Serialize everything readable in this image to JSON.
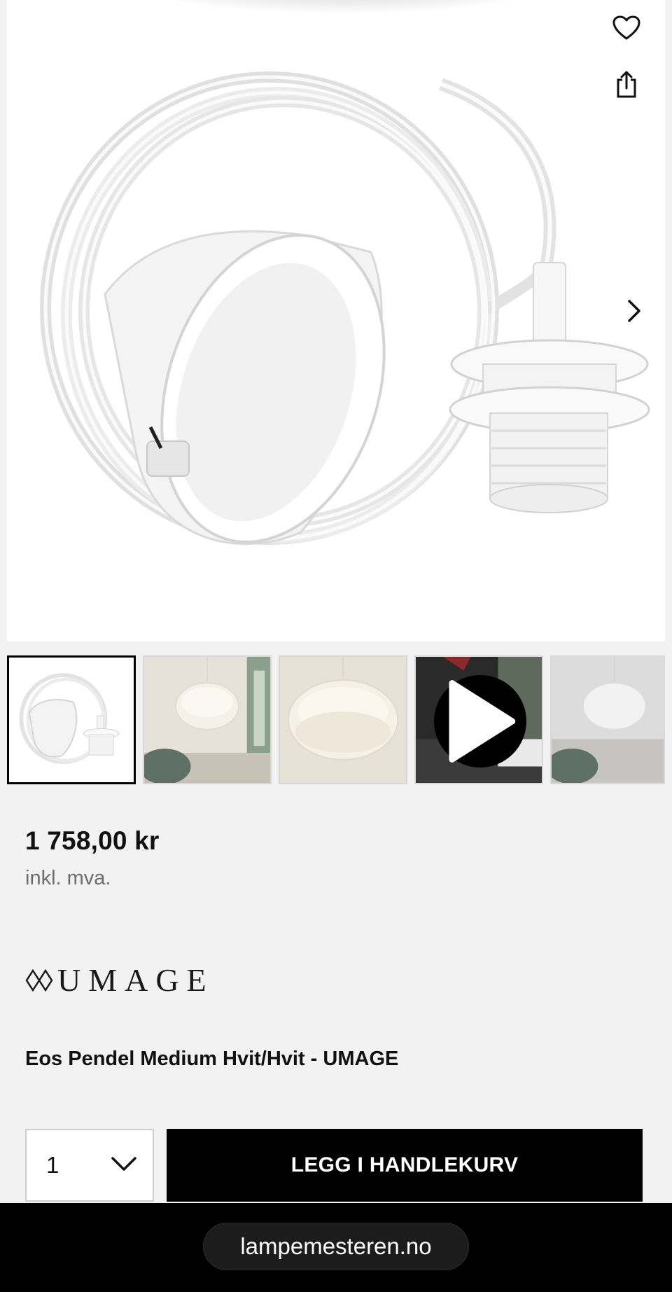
{
  "gallery": {
    "favorite_icon": "heart-outline-icon",
    "share_icon": "share-icon",
    "next_icon": "chevron-right-icon",
    "thumbnails": [
      {
        "kind": "image",
        "subject": "cord set",
        "active": true
      },
      {
        "kind": "image",
        "subject": "feather pendant in room"
      },
      {
        "kind": "image",
        "subject": "feather pendant close-up"
      },
      {
        "kind": "video",
        "subject": "assembly video",
        "play_icon": "play-icon"
      },
      {
        "kind": "image",
        "subject": "feather pendant white"
      }
    ]
  },
  "product": {
    "price": "1 758,00 kr",
    "vat_note": "inkl. mva.",
    "brand": "UMAGE",
    "title": "Eos Pendel Medium Hvit/Hvit - UMAGE"
  },
  "purchase": {
    "quantity": "1",
    "add_to_cart_label": "LEGG I HANDLEKURV"
  },
  "browser": {
    "url": "lampemesteren.no"
  },
  "colors": {
    "accent": "#000000",
    "page_background": "#f2f2f2",
    "muted_text": "#6d6d6d"
  }
}
